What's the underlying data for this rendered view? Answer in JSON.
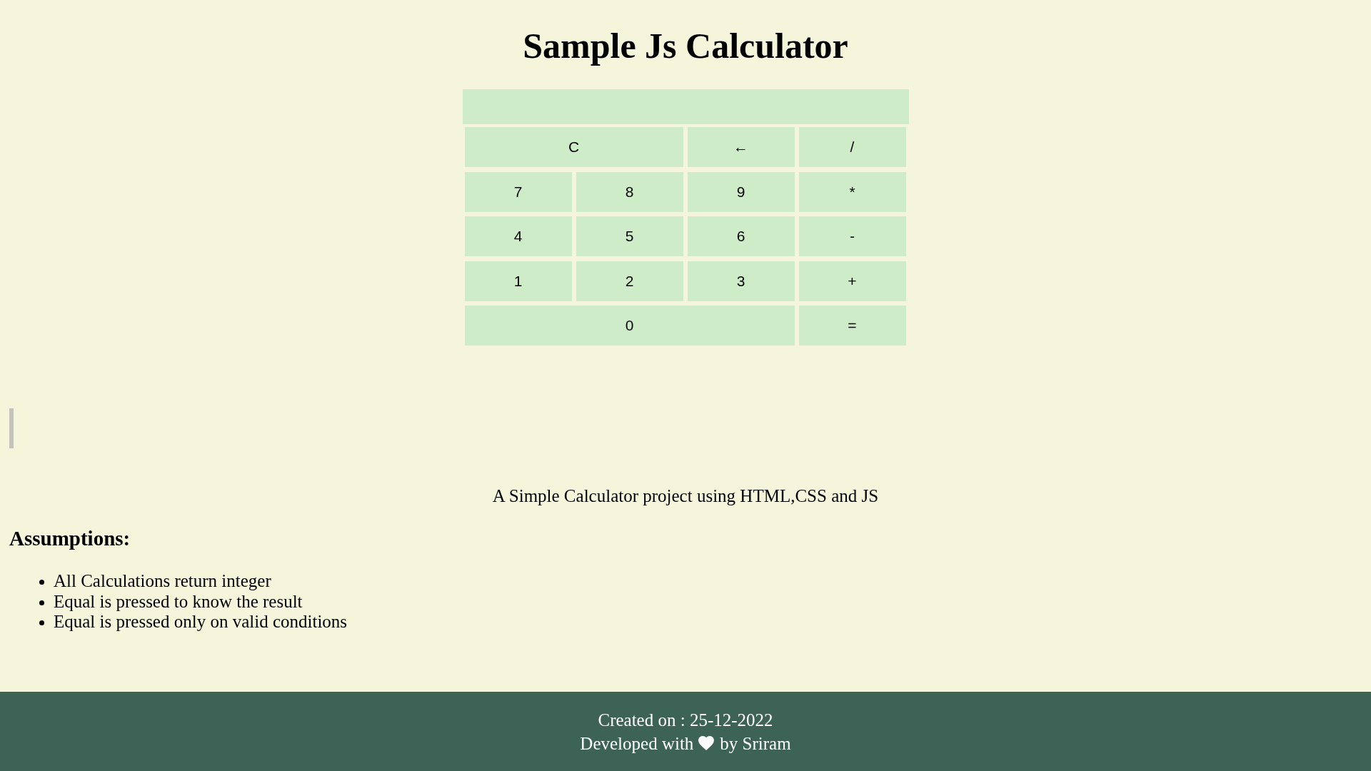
{
  "title": "Sample Js Calculator",
  "calculator": {
    "keys": [
      [
        "C",
        "←",
        "/"
      ],
      [
        "7",
        "8",
        "9",
        "*"
      ],
      [
        "4",
        "5",
        "6",
        "-"
      ],
      [
        "1",
        "2",
        "3",
        "+"
      ],
      [
        "0",
        "="
      ]
    ]
  },
  "description": "A Simple Calculator project using HTML,CSS and JS",
  "assumptions": {
    "heading": "Assumptions:",
    "items": [
      "All Calculations return integer",
      "Equal is pressed to know the result",
      "Equal is pressed only on valid conditions"
    ]
  },
  "footer": {
    "created_on": "Created on : 25-12-2022",
    "developed_with": "Developed with",
    "developed_by": "by Sriram"
  }
}
